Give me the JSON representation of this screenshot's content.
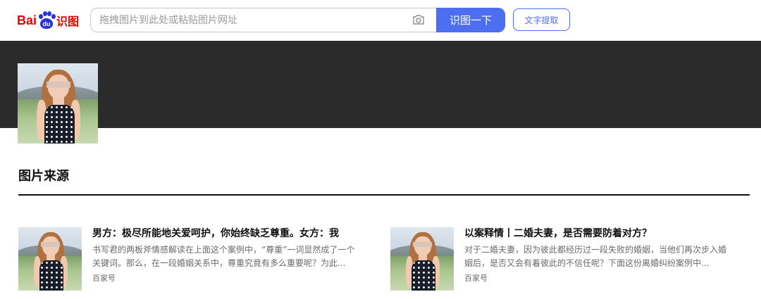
{
  "logo": {
    "bai": "Bai",
    "du": "du",
    "shitu": "识图"
  },
  "search": {
    "placeholder": "拖拽图片到此处或粘贴图片网址",
    "button_label": "识图一下",
    "text_extract_label": "文字提取"
  },
  "section": {
    "title": "图片来源"
  },
  "results": [
    {
      "title": "男方：极尽所能地关爱呵护，你始终缺乏尊重。女方：我",
      "description": "书写君的两板斧情感解读在上面这个案例中，“尊重”一词显然成了一个关键词。那么，在一段婚姻关系中，尊重究竟有多么重要呢？为此...",
      "source": "百家号"
    },
    {
      "title": "以案释情丨二婚夫妻，是否需要防着对方？",
      "description": "对于二婚夫妻，因为彼此都经历过一段失败的婚姻，当他们再次步入婚姻后，是否又会有着彼此的不信任呢？下面这份离婚纠纷案例中...",
      "source": "百家号"
    }
  ],
  "colors": {
    "accent": "#4e6ef2",
    "brand_red": "#e10601",
    "brand_blue": "#2932e1",
    "band": "#2b2b2b"
  }
}
